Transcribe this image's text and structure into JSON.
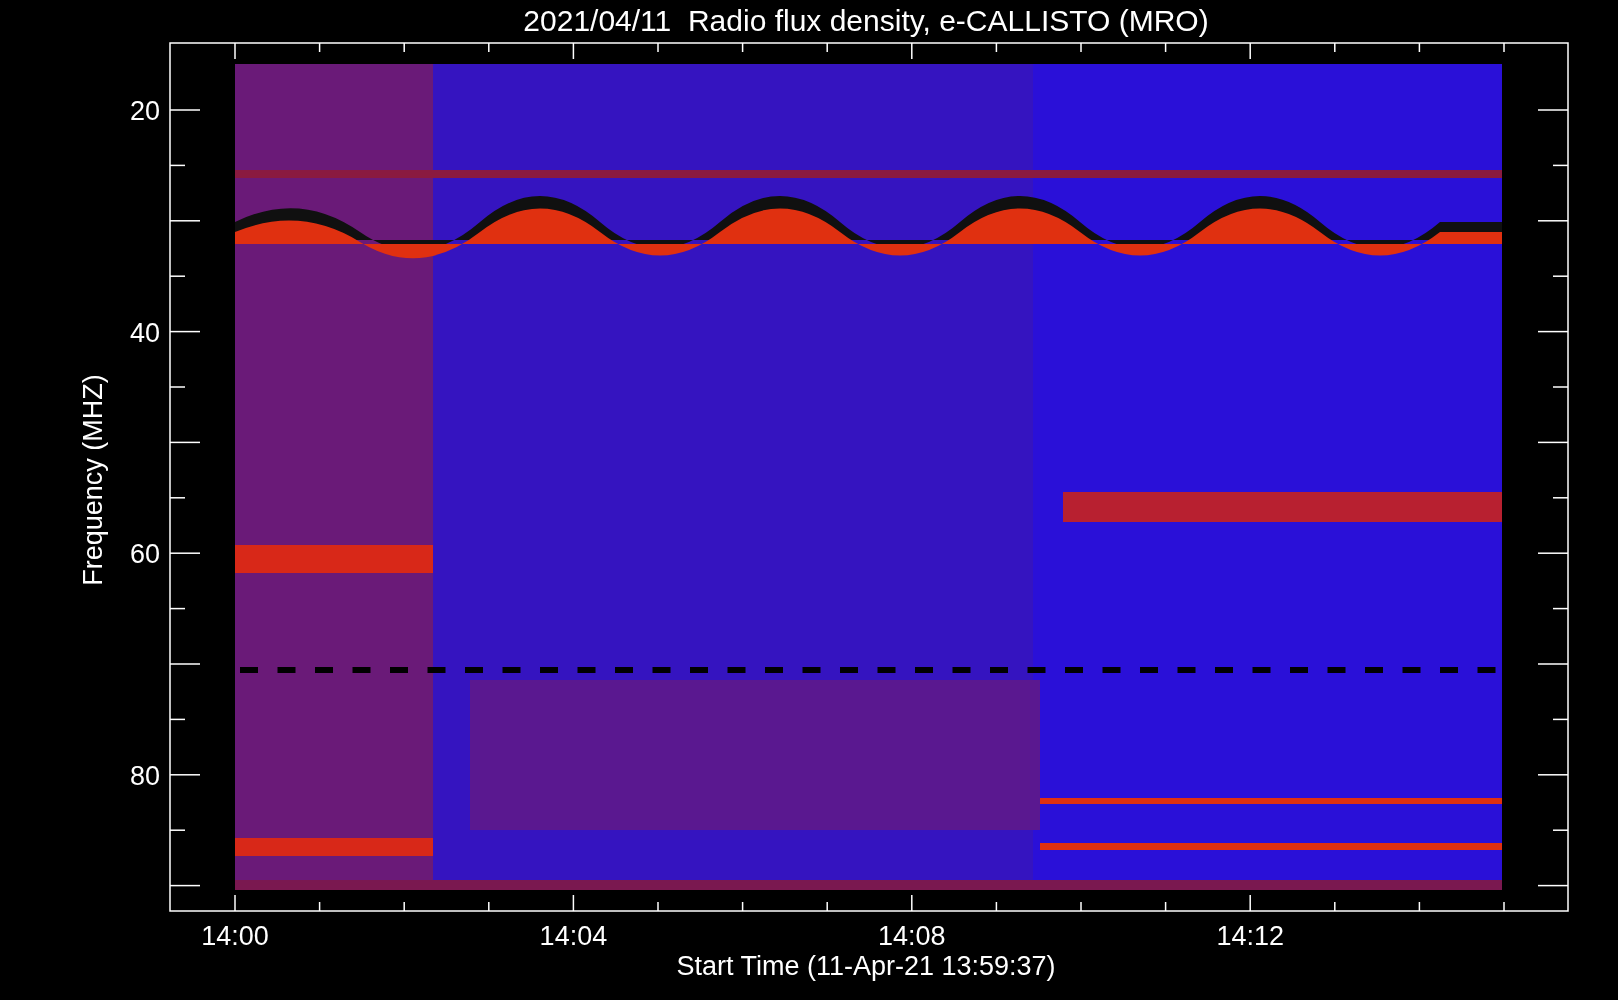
{
  "plot": {
    "title": "2021/04/11  Radio flux density, e-CALLISTO (MRO)",
    "y_axis": {
      "label": "Frequency (MHZ)",
      "ticks": [
        "20",
        "40",
        "60",
        "80"
      ]
    },
    "x_axis": {
      "label": "Start Time (11-Apr-21 13:59:37)",
      "ticks": [
        "14:00",
        "14:04",
        "14:08",
        "14:12"
      ]
    }
  }
}
